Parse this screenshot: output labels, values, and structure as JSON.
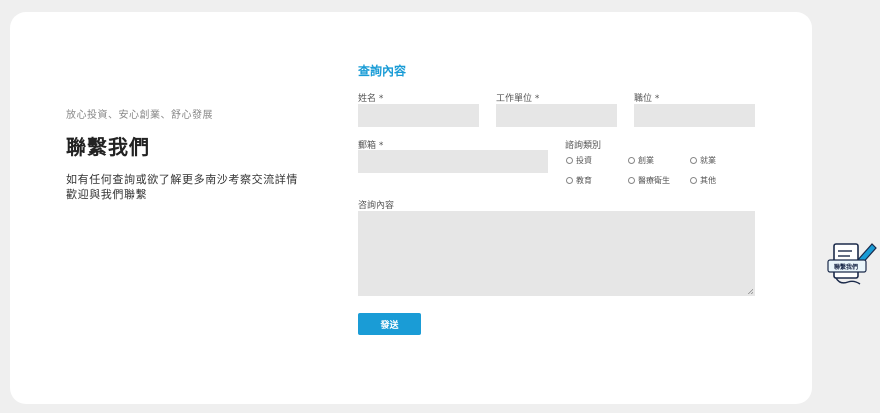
{
  "left": {
    "tagline": "放心投資、安心創業、舒心發展",
    "heading": "聯繫我們",
    "desc_line1": "如有任何查詢或欲了解更多南沙考察交流詳情",
    "desc_line2": "歡迎與我們聯繫"
  },
  "form": {
    "title": "查詢內容",
    "name_label": "姓名 *",
    "org_label": "工作單位 *",
    "position_label": "職位 *",
    "email_label": "郵箱 *",
    "category_label": "諮詢類別",
    "categories": [
      "投資",
      "創業",
      "就業",
      "教育",
      "醫療衛生",
      "其他"
    ],
    "message_label": "咨詢內容",
    "submit_label": "發送"
  },
  "floating": {
    "label": "聯繫我們",
    "icon": "contact-form-pen-icon"
  },
  "colors": {
    "accent": "#1a9cd6",
    "field_bg": "#e6e6e6",
    "page_bg": "#efefef"
  }
}
